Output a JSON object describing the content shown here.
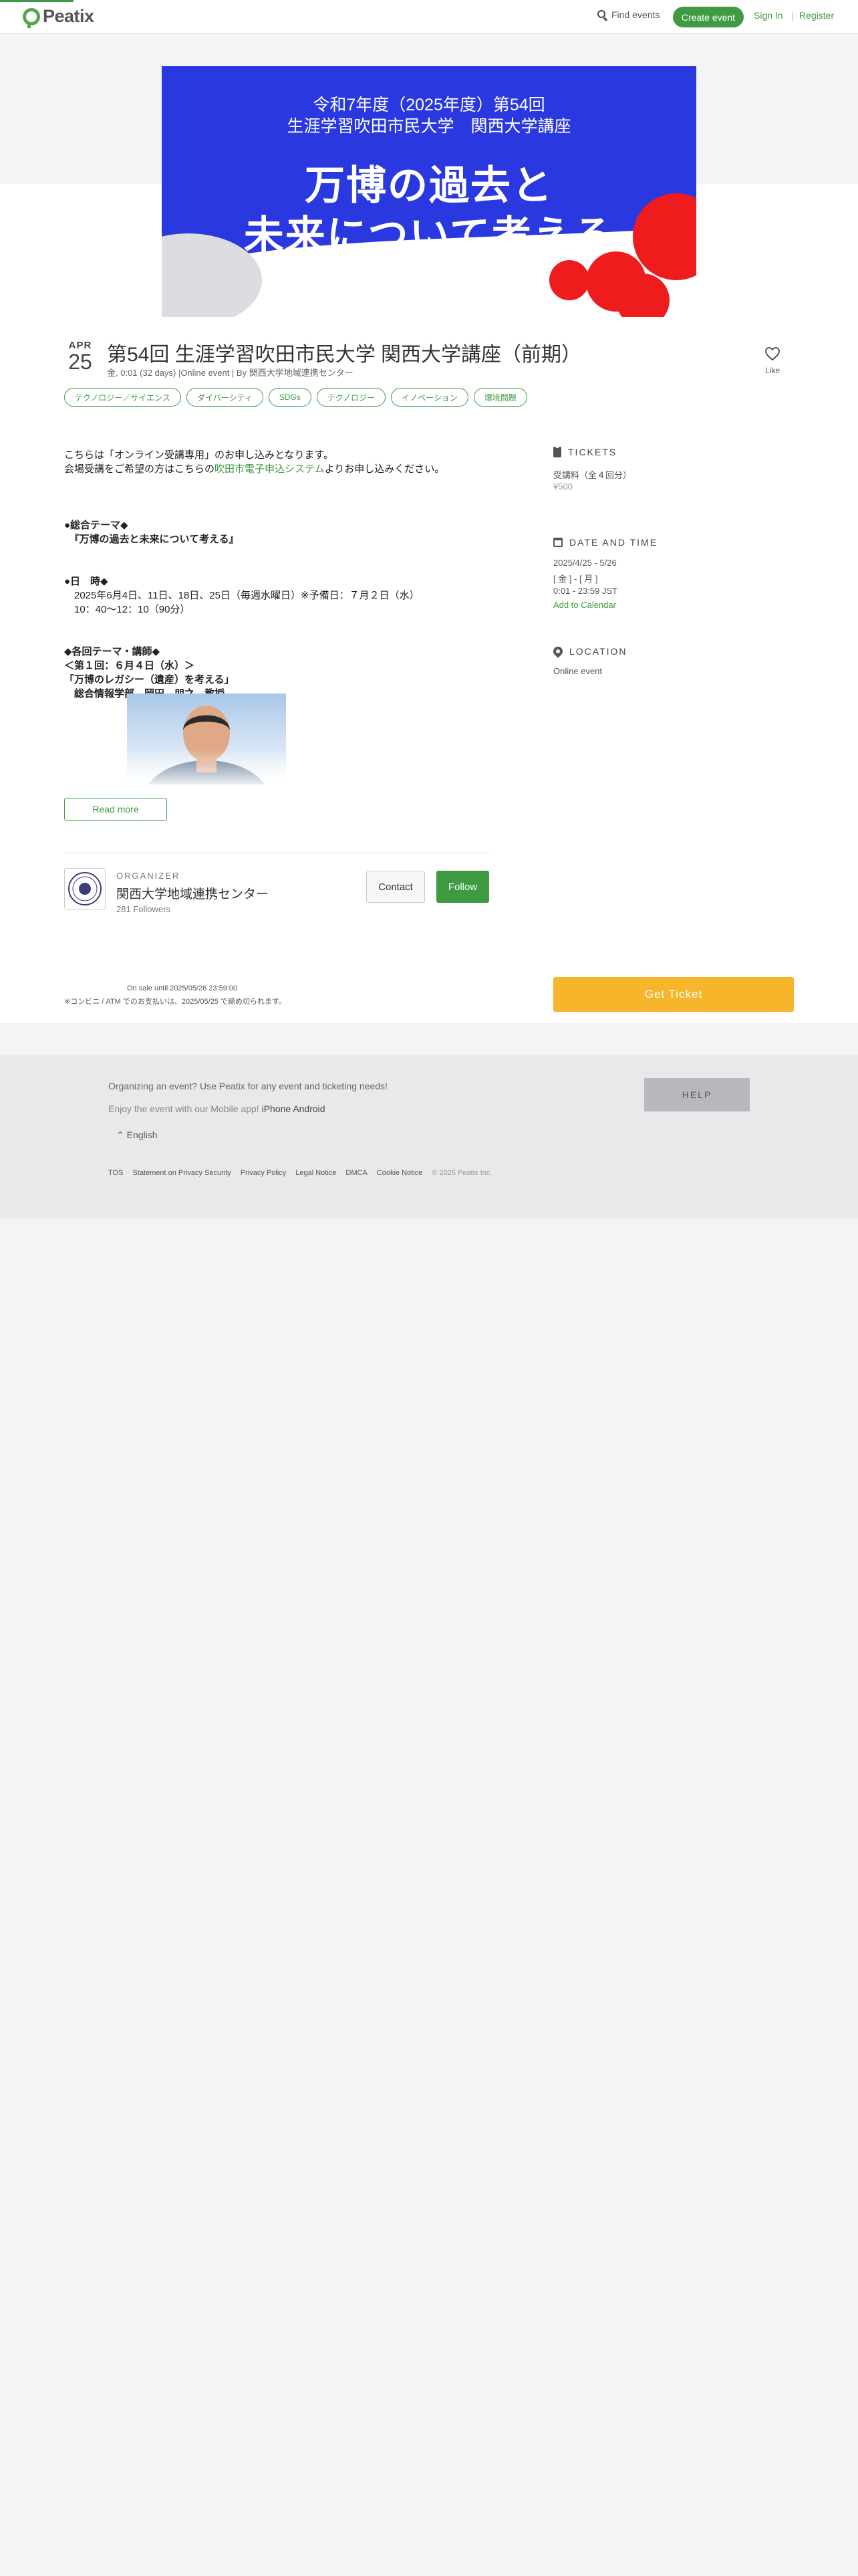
{
  "header": {
    "logo_text": "Peatix",
    "find_events": "Find events",
    "create_event": "Create event",
    "sign_in": "Sign In",
    "separator": "|",
    "register": "Register"
  },
  "banner": {
    "line1": "令和7年度（2025年度）第54回",
    "line2": "生涯学習吹田市民大学　関西大学講座",
    "main1": "万博の過去と",
    "main2": "未来について考える"
  },
  "event": {
    "month": "APR",
    "day": "25",
    "title": "第54回 生涯学習吹田市民大学 関西大学講座（前期）",
    "meta": "金, 0:01 (32 days) |Online event | By 関西大学地域連携センター",
    "like_label": "Like",
    "tags": [
      "テクノロジー／サイエンス",
      "ダイバーシティ",
      "SDGs",
      "テクノロジー",
      "イノベーション",
      "環境問題"
    ]
  },
  "description": {
    "l1": "こちらは「オンライン受講専用」のお申し込みとなります。",
    "l2a": "会場受講をご希望の方はこちらの",
    "l2_link": "吹田市電子申込システム",
    "l2b": "よりお申し込みください。",
    "l3": "●総合テーマ◆",
    "l4": "　『万博の過去と未来について考える』",
    "l5": "●日　時◆",
    "l6": "　2025年6月4日、11日、18日、25日（毎週水曜日）※予備日：７月２日（水）",
    "l7": "　10：40～12：10（90分）",
    "l8": "◆各回テーマ・講師◆",
    "l9": "＜第１回：６月４日（水）＞",
    "l10": "「万博のレガシー（遺産）を考える」",
    "l11": "　総合情報学部　岡田　朋之　教授",
    "read_more": "Read more"
  },
  "organizer": {
    "label": "ORGANIZER",
    "name": "関西大学地域連携センター",
    "followers": "281 Followers",
    "contact": "Contact",
    "follow": "Follow"
  },
  "sidebar": {
    "tickets_head": "TICKETS",
    "ticket_name": "受講料（全４回分）",
    "ticket_price": "¥500",
    "date_head": "DATE AND TIME",
    "date_range": "2025/4/25 - 5/26",
    "weekday": "[ 金 ] - [ 月 ]",
    "time_range": "0:01 - 23:59 JST",
    "add_calendar": "Add to Calendar",
    "location_head": "LOCATION",
    "location": "Online event"
  },
  "purchase": {
    "on_sale": "On sale until 2025/05/26 23:59:00",
    "note": "※コンビニ / ATM でのお支払いは、2025/05/25 で締め切られます。",
    "get_ticket": "Get Ticket"
  },
  "footer": {
    "lead": "Organizing an event? Use Peatix for any event and ticketing needs!",
    "app_prefix": "Enjoy the event with our Mobile app!",
    "iphone": "iPhone",
    "android": "Android",
    "language": "English",
    "help": "HELP",
    "links": [
      "TOS",
      "Statement on Privacy Security",
      "Privacy Policy",
      "Legal Notice",
      "DMCA",
      "Cookie Notice"
    ],
    "copyright": "© 2025 Peatix Inc."
  },
  "colors": {
    "brand_green": "#3f9b43",
    "banner_blue": "#2a38e0",
    "banner_red": "#ee1c1c",
    "ticket_button": "#f6b52b"
  }
}
